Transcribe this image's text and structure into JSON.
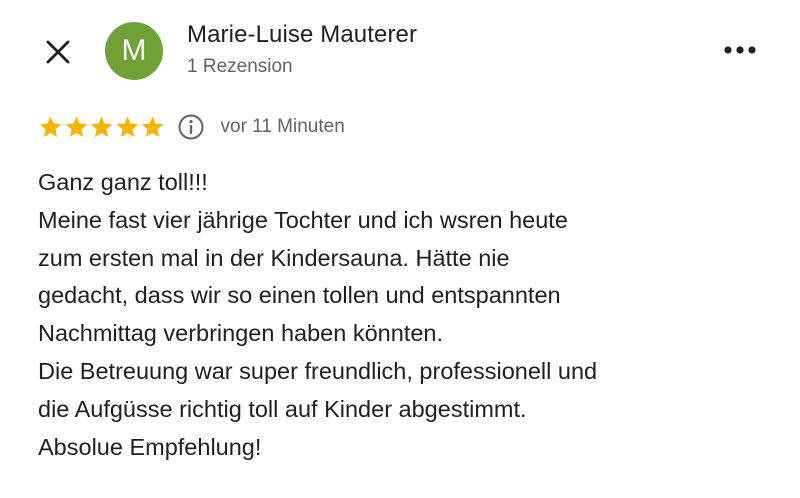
{
  "header": {
    "close_icon": "close-icon",
    "avatar_letter": "M",
    "avatar_color": "#6fa136",
    "reviewer_name": "Marie-Luise Mauterer",
    "review_count": "1 Rezension",
    "more_icon": "more-horizontal-icon"
  },
  "rating": {
    "stars": 5,
    "max_stars": 5,
    "star_color": "#f4b400",
    "info_icon": "info-icon",
    "time_label": "vor 11 Minuten"
  },
  "review": {
    "lines": [
      "Ganz ganz toll!!!",
      "Meine fast vier jährige Tochter und ich wsren heute",
      "zum ersten mal in der Kindersauna. Hätte nie",
      "gedacht, dass wir so einen tollen und entspannten",
      "Nachmittag verbringen haben könnten.",
      "Die Betreuung war super freundlich, professionell und",
      "die Aufgüsse richtig toll auf Kinder abgestimmt.",
      "Absolue Empfehlung!"
    ]
  }
}
